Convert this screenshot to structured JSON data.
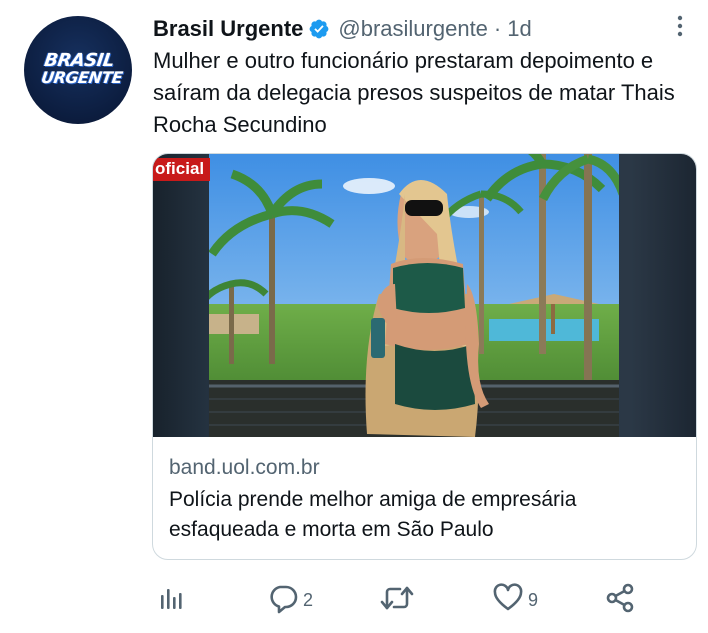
{
  "author": {
    "display_name": "Brasil Urgente",
    "handle": "@brasilurgente",
    "separator": "·",
    "time": "1d",
    "avatar_logo_line1": "BRASIL",
    "avatar_logo_line2": "URGENTE"
  },
  "tweet_text": "Mulher e outro funcionário prestaram depoimento e saíram da delegacia presos suspeitos de matar Thais Rocha Secundino",
  "card": {
    "badge": "oficial",
    "domain": "band.uol.com.br",
    "title": "Polícia prende melhor amiga de empresária esfaqueada e morta em São Paulo"
  },
  "actions": {
    "analytics_icon": "analytics-icon",
    "reply_icon": "reply-icon",
    "reply_count": "2",
    "retweet_icon": "retweet-icon",
    "like_icon": "heart-icon",
    "like_count": "9",
    "share_icon": "share-icon"
  },
  "colors": {
    "text": "#0f1419",
    "secondary_text": "#536471",
    "verified_blue": "#1d9bf0",
    "border": "#cfd9de",
    "badge_red": "#c81a1a"
  }
}
